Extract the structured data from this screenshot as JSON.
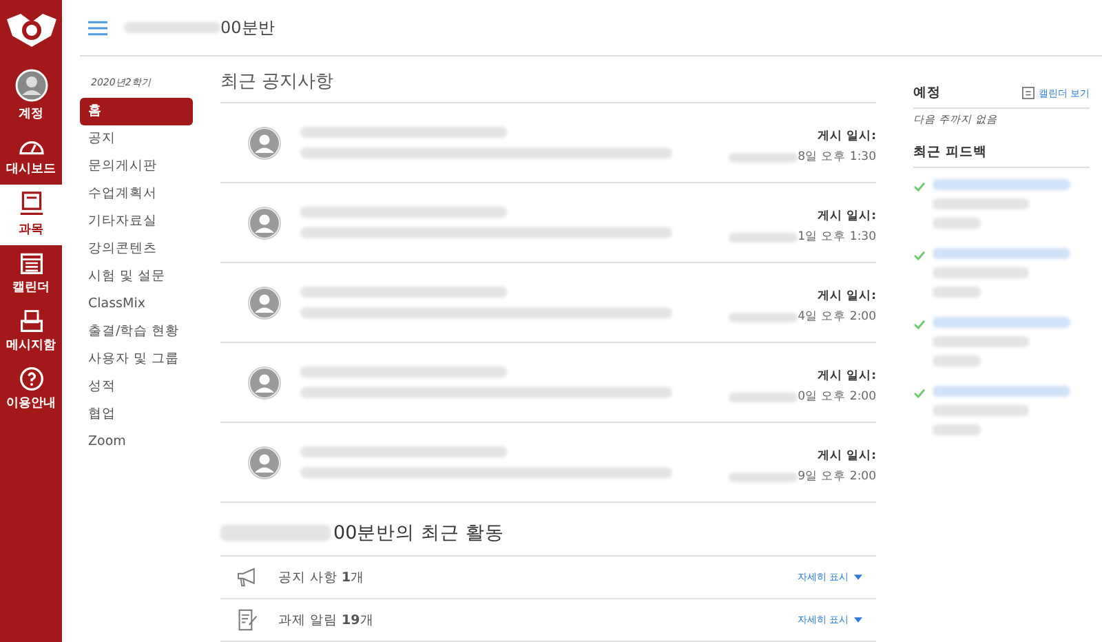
{
  "global_nav": [
    {
      "kind": "account",
      "label": "계정",
      "selected": false
    },
    {
      "kind": "dashboard",
      "label": "대시보드",
      "selected": false
    },
    {
      "kind": "courses",
      "label": "과목",
      "selected": true
    },
    {
      "kind": "calendar",
      "label": "캘린더",
      "selected": false
    },
    {
      "kind": "inbox",
      "label": "메시지함",
      "selected": false
    },
    {
      "kind": "help",
      "label": "이용안내",
      "selected": false
    }
  ],
  "header": {
    "title": "00분반"
  },
  "course_nav": {
    "term": "2020년2학기",
    "items": [
      {
        "label": "홈",
        "selected": true
      },
      {
        "label": "공지",
        "selected": false
      },
      {
        "label": "문의게시판",
        "selected": false
      },
      {
        "label": "수업계획서",
        "selected": false
      },
      {
        "label": "기타자료실",
        "selected": false
      },
      {
        "label": "강의콘텐츠",
        "selected": false
      },
      {
        "label": "시험 및 설문",
        "selected": false
      },
      {
        "label": "ClassMix",
        "selected": false
      },
      {
        "label": "출결/학습 현황",
        "selected": false
      },
      {
        "label": "사용자 및 그룹",
        "selected": false
      },
      {
        "label": "성적",
        "selected": false
      },
      {
        "label": "협업",
        "selected": false
      },
      {
        "label": "Zoom",
        "selected": false
      }
    ]
  },
  "announcements": {
    "title": "최근 공지사항",
    "items": [
      {
        "posted_label": "게시 일시:",
        "posted_at": "8일 오후 1:30"
      },
      {
        "posted_label": "게시 일시:",
        "posted_at": "1일 오후 1:30"
      },
      {
        "posted_label": "게시 일시:",
        "posted_at": "4일 오후 2:00"
      },
      {
        "posted_label": "게시 일시:",
        "posted_at": "0일 오후 2:00"
      },
      {
        "posted_label": "게시 일시:",
        "posted_at": "9일 오후 2:00"
      }
    ]
  },
  "activity": {
    "title": "00분반의 최근 활동",
    "items": [
      {
        "kind": "announcement",
        "label": "공지 사항 **1**개",
        "link": "자세히 표시"
      },
      {
        "kind": "assignment",
        "label": "과제 알림 **19**개",
        "link": "자세히 표시"
      }
    ]
  },
  "sidebar": {
    "todo_title": "예정",
    "calendar_link": "캘린더 보기",
    "todo_empty": "다음 주까지 없음",
    "feedback_title": "최근 피드백",
    "feedback": [
      {
        "kind": "check"
      },
      {
        "kind": "check"
      },
      {
        "kind": "check"
      },
      {
        "kind": "check"
      }
    ]
  }
}
